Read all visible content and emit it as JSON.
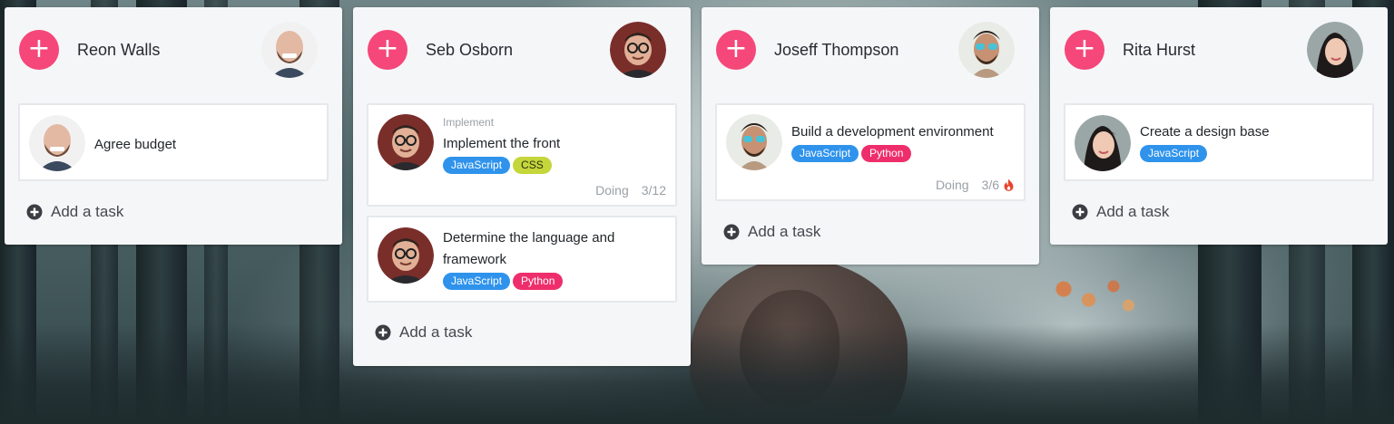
{
  "columns": [
    {
      "member": "Reon Walls",
      "avatar": "bald-bearded-man-avatar",
      "tasks": [
        {
          "avatar": "bald-bearded-man-avatar",
          "title": "Agree budget"
        }
      ],
      "add_task_label": "Add a task"
    },
    {
      "member": "Seb Osborn",
      "avatar": "man-with-glasses-avatar",
      "tasks": [
        {
          "avatar": "man-with-glasses-avatar",
          "category": "Implement",
          "title": "Implement the front",
          "tags": [
            "JavaScript",
            "CSS"
          ],
          "status": "Doing",
          "progress": "3/12"
        },
        {
          "avatar": "man-with-glasses-avatar",
          "title_line1": "Determine the language and",
          "title_line2": "framework",
          "tags": [
            "JavaScript",
            "Python"
          ]
        }
      ],
      "add_task_label": "Add a task"
    },
    {
      "member": "Joseff Thompson",
      "avatar": "man-with-sunglasses-avatar",
      "tasks": [
        {
          "avatar": "man-with-sunglasses-avatar",
          "title": "Build a development environment",
          "tags": [
            "JavaScript",
            "Python"
          ],
          "status": "Doing",
          "progress": "3/6",
          "flag_icon": "fire-icon"
        }
      ],
      "add_task_label": "Add a task"
    },
    {
      "member": "Rita Hurst",
      "avatar": "woman-dark-hair-avatar",
      "tasks": [
        {
          "avatar": "woman-dark-hair-avatar",
          "title": "Create a design base",
          "tags": [
            "JavaScript"
          ]
        }
      ],
      "add_task_label": "Add a task"
    }
  ],
  "icons": {
    "add_member_task": "plus-circle-icon",
    "add_task": "plus-circle-icon"
  },
  "colors": {
    "accent": "#f5477a",
    "javascript_tag": "#2f93ec",
    "css_tag": "#c5d63a",
    "python_tag": "#ee2e6b",
    "fire": "#e8452c"
  }
}
